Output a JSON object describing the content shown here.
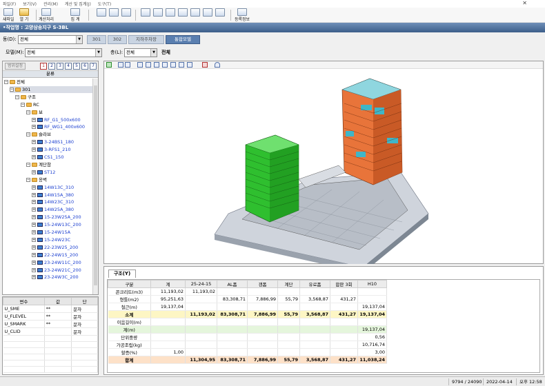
{
  "menu": [
    "파일(F)",
    "보기(V)",
    "관리(M)",
    "계산 및 집계(J)",
    "도구(T)"
  ],
  "toolbar": {
    "buttons": [
      "새파일",
      "열 기",
      "계산처리",
      "집 계",
      "등록정보"
    ]
  },
  "project_title": "•작업명 : 고양삼송지구 S-3BL",
  "building": {
    "label": "동(D):",
    "value": "전체",
    "tabs": [
      "301",
      "302",
      "지하주차장",
      "통합모델"
    ],
    "active_tab": 3
  },
  "model_row": {
    "model_label": "모델(M):",
    "model_value": "전체",
    "floor_label": "층(L):",
    "floor_value": "전체",
    "floor_display": "전체"
  },
  "left_panel": {
    "range_button": "범위설정",
    "number_buttons": [
      "1",
      "2",
      "3",
      "4",
      "5",
      "6",
      "7"
    ],
    "header": "분류",
    "tree": [
      {
        "label": "전체",
        "level": 0,
        "type": "folder"
      },
      {
        "label": "301",
        "level": 1,
        "type": "folder",
        "selected": true
      },
      {
        "label": "구조",
        "level": 2,
        "type": "folder"
      },
      {
        "label": "RC",
        "level": 3,
        "type": "folder"
      },
      {
        "label": "보",
        "level": 4,
        "type": "folder"
      },
      {
        "label": "RF_G1_500x600",
        "level": 5,
        "type": "leaf"
      },
      {
        "label": "RF_WG1_400x600",
        "level": 5,
        "type": "leaf"
      },
      {
        "label": "슬라브",
        "level": 4,
        "type": "folder"
      },
      {
        "label": "3-24BS1_180",
        "level": 5,
        "type": "leaf"
      },
      {
        "label": "3-RFS1_210",
        "level": 5,
        "type": "leaf"
      },
      {
        "label": "CS1_150",
        "level": 5,
        "type": "leaf"
      },
      {
        "label": "계단참",
        "level": 4,
        "type": "folder"
      },
      {
        "label": "ST12",
        "level": 5,
        "type": "leaf"
      },
      {
        "label": "옹벽",
        "level": 4,
        "type": "folder"
      },
      {
        "label": "14W13C_310",
        "level": 5,
        "type": "leaf"
      },
      {
        "label": "14W15A_380",
        "level": 5,
        "type": "leaf"
      },
      {
        "label": "14W23C_310",
        "level": 5,
        "type": "leaf"
      },
      {
        "label": "14W25A_380",
        "level": 5,
        "type": "leaf"
      },
      {
        "label": "15-23W25A_200",
        "level": 5,
        "type": "leaf"
      },
      {
        "label": "15-24W13C_200",
        "level": 5,
        "type": "leaf"
      },
      {
        "label": "15-24W15A",
        "level": 5,
        "type": "leaf"
      },
      {
        "label": "15-24W23C",
        "level": 5,
        "type": "leaf"
      },
      {
        "label": "22-23W25_200",
        "level": 5,
        "type": "leaf"
      },
      {
        "label": "22-24W15_200",
        "level": 5,
        "type": "leaf"
      },
      {
        "label": "23-24W11C_200",
        "level": 5,
        "type": "leaf"
      },
      {
        "label": "23-24W21C_200",
        "level": 5,
        "type": "leaf"
      },
      {
        "label": "23-24W3C_200",
        "level": 5,
        "type": "leaf"
      }
    ]
  },
  "variables": {
    "headers": [
      "변수",
      "값",
      "단"
    ],
    "rows": [
      [
        "U_SME",
        "**",
        "문자"
      ],
      [
        "U_FLEVEL",
        "**",
        "문자"
      ],
      [
        "U_SMARK",
        "**",
        "문자"
      ],
      [
        "U_CLID",
        "",
        "문자"
      ]
    ]
  },
  "result": {
    "tab_label": "구조(Y)",
    "columns": [
      "구분",
      "계",
      "25-24-15",
      "AL폼",
      "갱폼",
      "계단",
      "유로폼",
      "합판 3회",
      "H10"
    ],
    "rows": [
      {
        "style": "",
        "cells": [
          "콘크리트(m3)",
          "11,193,02",
          "11,193,02",
          "",
          "",
          "",
          "",
          "",
          ""
        ]
      },
      {
        "style": "",
        "cells": [
          "형틀(m2)",
          "95,251,63",
          "",
          "83,308,71",
          "7,886,99",
          "55,79",
          "3,568,87",
          "431,27",
          ""
        ]
      },
      {
        "style": "",
        "cells": [
          "철근(m)",
          "19,137,04",
          "",
          "",
          "",
          "",
          "",
          "",
          "19,137,04"
        ]
      },
      {
        "style": "sub",
        "cells": [
          "소계",
          "",
          "11,193,02",
          "83,308,71",
          "7,886,99",
          "55,79",
          "3,568,87",
          "431,27",
          "19,137,04"
        ]
      },
      {
        "style": "",
        "cells": [
          "이음길이(m)",
          "",
          "",
          "",
          "",
          "",
          "",
          "",
          ""
        ]
      },
      {
        "style": "green",
        "cells": [
          "계(m)",
          "",
          "",
          "",
          "",
          "",
          "",
          "",
          "19,137,04"
        ]
      },
      {
        "style": "",
        "cells": [
          "단위중량",
          "",
          "",
          "",
          "",
          "",
          "",
          "",
          "0,56"
        ]
      },
      {
        "style": "",
        "cells": [
          "가공조립(kg)",
          "",
          "",
          "",
          "",
          "",
          "",
          "",
          "10,716,74"
        ]
      },
      {
        "style": "",
        "cells": [
          "할증(%)",
          "1,00",
          "",
          "",
          "",
          "",
          "",
          "",
          "3,00"
        ]
      },
      {
        "style": "total",
        "cells": [
          "합계",
          "",
          "11,304,95",
          "83,308,71",
          "7,886,99",
          "55,79",
          "3,568,87",
          "431,27",
          "11,038,24"
        ]
      }
    ]
  },
  "status": {
    "counts": "9794 / 24090",
    "date": "2022-04-14",
    "time": "오후 12:58"
  },
  "colors": {
    "title_bar": "#4a6b96",
    "green_building": "#2fbf2f",
    "orange_building": "#e8743a",
    "cyan_accent": "#3fb6c8",
    "podium": "#c9ced6"
  },
  "icons": [
    "close-icon",
    "new-file-icon",
    "open-folder-icon",
    "calculate-icon",
    "aggregate-icon",
    "properties-icon"
  ]
}
